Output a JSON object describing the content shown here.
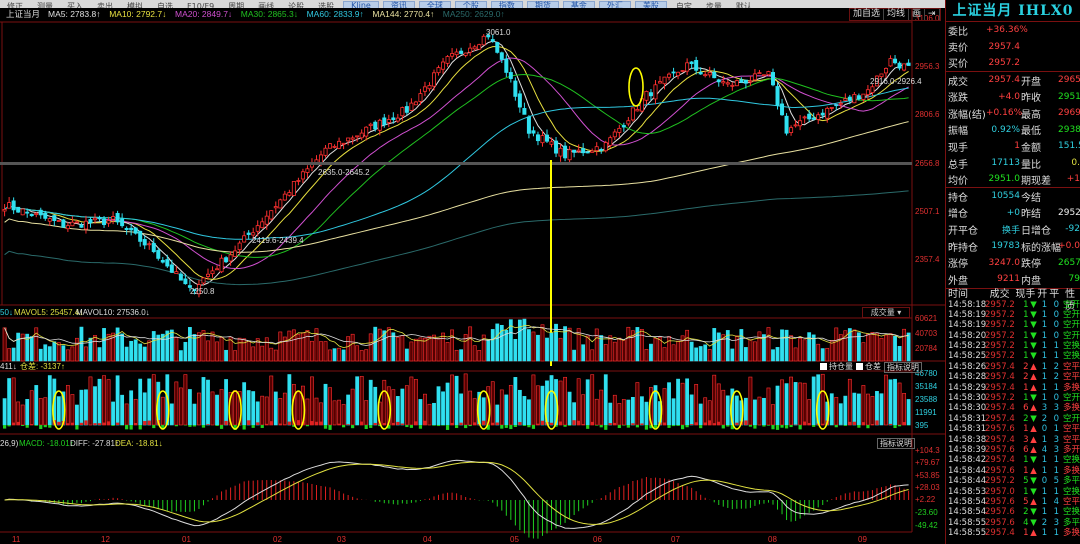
{
  "toolbar": [
    "修正",
    "测量",
    "买入",
    "卖出",
    "模拟",
    "自选",
    "F10/F9",
    "周期",
    "画线",
    "论股",
    "选股",
    "Kline",
    "资讯",
    "全球",
    "个股",
    "指数",
    "期货",
    "基金",
    "外汇",
    "美股",
    "自定",
    "步量",
    "默认"
  ],
  "header": {
    "name": "上证当月",
    "ma": [
      {
        "label": "MA5: 2783.8",
        "arrow": "↑",
        "color": "#e0e0e0"
      },
      {
        "label": "MA10: 2792.7",
        "arrow": "↓",
        "color": "#e8e040"
      },
      {
        "label": "MA20: 2849.7",
        "arrow": "↓",
        "color": "#d050d0"
      },
      {
        "label": "MA30: 2865.3",
        "arrow": "↓",
        "color": "#20c020"
      },
      {
        "label": "MA60: 2833.9",
        "arrow": "↑",
        "color": "#30c8e0"
      },
      {
        "label": "MA144: 2770.4",
        "arrow": "↑",
        "color": "#e8e0a0"
      },
      {
        "label": "MA250: 2629.0",
        "arrow": "↑",
        "color": "#2a6a6a"
      }
    ]
  },
  "chart_buttons": [
    "加自选",
    "均线",
    "画",
    "⇥"
  ],
  "price_axis": [
    "3106.0",
    "2956.3",
    "2806.6",
    "2656.8",
    "2507.1",
    "2357.4"
  ],
  "annotations": {
    "high": "3061.0",
    "low": "2250.8",
    "band1": "2635.0-2645.2",
    "band2": "2419.6-2439.4",
    "band3": "2916.0-2926.4"
  },
  "price_path": [
    [
      0,
      2528
    ],
    [
      13,
      2466
    ],
    [
      24,
      2480
    ],
    [
      33,
      2388
    ],
    [
      41,
      2262
    ],
    [
      51,
      2390
    ],
    [
      62,
      2558
    ],
    [
      71,
      2698
    ],
    [
      80,
      2760
    ],
    [
      89,
      2822
    ],
    [
      98,
      2976
    ],
    [
      107,
      3055
    ],
    [
      111,
      2945
    ],
    [
      116,
      2760
    ],
    [
      124,
      2682
    ],
    [
      133,
      2713
    ],
    [
      142,
      2868
    ],
    [
      151,
      2961
    ],
    [
      160,
      2899
    ],
    [
      169,
      2930
    ],
    [
      173,
      2760
    ],
    [
      182,
      2822
    ],
    [
      191,
      2883
    ],
    [
      196,
      2976
    ],
    [
      200,
      2950
    ]
  ],
  "volume": {
    "header_prefix": "50↓",
    "mavol5": "MAVOL5: 25457.4↓",
    "mavol10": "MAVOL10: 27536.0↓",
    "selector": "成交量 ▾",
    "axis": [
      "60621",
      "40703",
      "20784"
    ]
  },
  "oi": {
    "header": "411↓",
    "diff": "仓差: -3137↑",
    "checks": [
      "持仓量",
      "仓差"
    ],
    "help": "指标说明",
    "axis": [
      "46780",
      "35184",
      "23588",
      "11991",
      "395"
    ],
    "circles": [
      12,
      35,
      51,
      65,
      84,
      106,
      121,
      144,
      162,
      181
    ]
  },
  "macd": {
    "params": "26,9)",
    "macd": "MACD: -18.01↑",
    "diff": "DIFF: -27.81↑",
    "dea": "DEA: -18.81↓",
    "help": "指标说明",
    "axis": [
      "+104.3",
      "+79.67",
      "+53.85",
      "+28.03",
      "+2.22",
      "-23.60",
      "-49.42"
    ]
  },
  "months": [
    "11",
    "12",
    "01",
    "02",
    "03",
    "04",
    "05",
    "06",
    "07",
    "08",
    "09"
  ],
  "panel": {
    "title": "上证当月 IHLX0",
    "rows": [
      {
        "l": "委比",
        "v": "+36.36%",
        "vc": "red"
      },
      {
        "l": "卖价",
        "v": "2957.4",
        "vc": "red"
      },
      {
        "l": "买价",
        "v": "2957.2",
        "vc": "red",
        "sep": true
      },
      {
        "l": "成交",
        "v": "2957.4",
        "vc": "red",
        "l2": "开盘",
        "v2": "2965",
        "v2c": "red"
      },
      {
        "l": "涨跌",
        "v": "+4.0",
        "vc": "red",
        "l2": "昨收",
        "v2": "2951",
        "v2c": "grn"
      },
      {
        "l": "涨幅(结)",
        "v": "+0.16%",
        "vc": "red",
        "l2": "最高",
        "v2": "2969",
        "v2c": "red"
      },
      {
        "l": "振幅",
        "v": "0.92%",
        "vc": "cyn",
        "l2": "最低",
        "v2": "2938",
        "v2c": "grn"
      },
      {
        "l": "现手",
        "v": "1",
        "vc": "red",
        "l2": "金额",
        "v2": "151.5",
        "v2c": "cyn"
      },
      {
        "l": "总手",
        "v": "17113",
        "vc": "cyn",
        "l2": "量比",
        "v2": "0.",
        "v2c": "yel"
      },
      {
        "l": "均价",
        "v": "2951.0",
        "vc": "grn",
        "l2": "期现差",
        "v2": "+1",
        "v2c": "red",
        "sep": true
      },
      {
        "l": "持仓",
        "v": "10554",
        "vc": "cyn",
        "l2": "今结",
        "v2": "",
        "v2c": "wht"
      },
      {
        "l": "增仓",
        "v": "+0",
        "vc": "cyn",
        "l2": "昨结",
        "v2": "2952",
        "v2c": "wht"
      },
      {
        "l": "开平仓",
        "v": "换手",
        "vc": "cyn",
        "l2": "日增仓",
        "v2": "-92",
        "v2c": "cyn"
      },
      {
        "l": "昨持仓",
        "v": "19783",
        "vc": "cyn",
        "l2": "标的涨幅",
        "v2": "+0.0",
        "v2c": "red"
      },
      {
        "l": "涨停",
        "v": "3247.0",
        "vc": "red",
        "l2": "跌停",
        "v2": "2657",
        "v2c": "grn"
      },
      {
        "l": "外盘",
        "v": "9211",
        "vc": "red",
        "l2": "内盘",
        "v2": "79",
        "v2c": "grn"
      }
    ],
    "trade_header": [
      "时间",
      "成交",
      "现手",
      "开",
      "平",
      "性质"
    ],
    "trades": [
      [
        "14:58:18",
        "2957.2",
        "1",
        "dn",
        "1",
        "0",
        "空开"
      ],
      [
        "14:58:19",
        "2957.2",
        "1",
        "dn",
        "1",
        "0",
        "空开"
      ],
      [
        "14:58:19",
        "2957.2",
        "1",
        "dn",
        "1",
        "0",
        "空开"
      ],
      [
        "14:58:20",
        "2957.2",
        "1",
        "dn",
        "1",
        "0",
        "空开"
      ],
      [
        "14:58:23",
        "2957.2",
        "1",
        "dn",
        "1",
        "1",
        "空换"
      ],
      [
        "14:58:25",
        "2957.2",
        "1",
        "dn",
        "1",
        "1",
        "空换"
      ],
      [
        "14:58:26",
        "2957.4",
        "2",
        "up",
        "1",
        "2",
        "空平"
      ],
      [
        "14:58:28",
        "2957.4",
        "2",
        "up",
        "1",
        "2",
        "空平"
      ],
      [
        "14:58:29",
        "2957.4",
        "1",
        "up",
        "1",
        "1",
        "多换"
      ],
      [
        "14:58:30",
        "2957.2",
        "1",
        "dn",
        "1",
        "0",
        "空开"
      ],
      [
        "14:58:30",
        "2957.4",
        "6",
        "up",
        "3",
        "3",
        "多换"
      ],
      [
        "14:58:31",
        "2957.4",
        "2",
        "dn",
        "2",
        "0",
        "空开"
      ],
      [
        "14:58:31",
        "2957.6",
        "1",
        "up",
        "0",
        "1",
        "空平"
      ],
      [
        "14:58:38",
        "2957.4",
        "3",
        "up",
        "1",
        "3",
        "空平"
      ],
      [
        "14:58:39",
        "2957.6",
        "6",
        "up",
        "4",
        "3",
        "多开"
      ],
      [
        "14:58:42",
        "2957.4",
        "1",
        "dn",
        "1",
        "1",
        "空换"
      ],
      [
        "14:58:44",
        "2957.6",
        "1",
        "up",
        "1",
        "1",
        "多换"
      ],
      [
        "14:58:44",
        "2957.2",
        "5",
        "dn",
        "0",
        "5",
        "多平"
      ],
      [
        "14:58:53",
        "2957.0",
        "1",
        "dn",
        "1",
        "1",
        "空换"
      ],
      [
        "14:58:54",
        "2957.6",
        "5",
        "up",
        "1",
        "4",
        "空平"
      ],
      [
        "14:58:54",
        "2957.6",
        "2",
        "dn",
        "1",
        "1",
        "空换"
      ],
      [
        "14:58:55",
        "2957.6",
        "4",
        "dn",
        "2",
        "3",
        "多平"
      ],
      [
        "14:58:55",
        "2957.4",
        "1",
        "up",
        "1",
        "1",
        "多换"
      ]
    ]
  },
  "colors": {
    "up": "#ff3030",
    "down": "#30e0f0",
    "frame": "#7a1010",
    "highlight": "#ffff00"
  }
}
